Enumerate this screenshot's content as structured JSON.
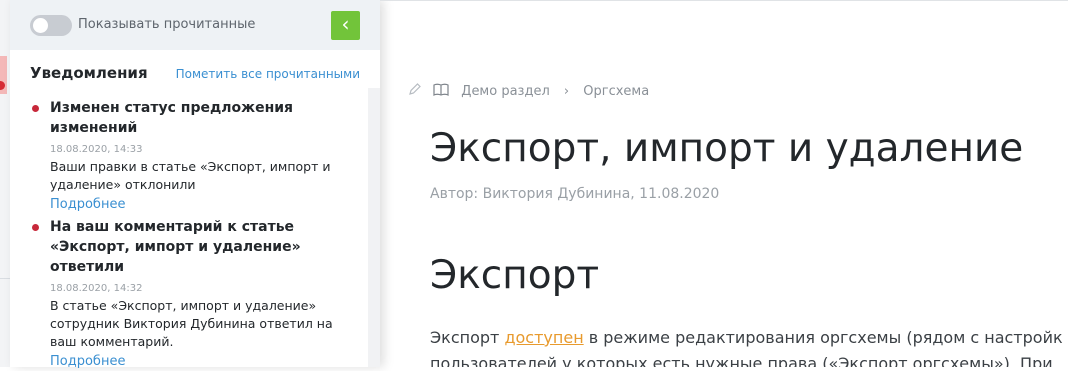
{
  "panel": {
    "toggle_label": "Показывать прочитанные",
    "collapse_icon": "‹",
    "title": "Уведомления",
    "mark_all": "Пометить все прочитанными",
    "notifications": [
      {
        "title": "Изменен статус предложения изменений",
        "date": "18.08.2020, 14:33",
        "text": "Ваши правки в статье «Экспорт, импорт и удаление» отклонили",
        "more": "Подробнее"
      },
      {
        "title": "На ваш комментарий к статье «Экспорт, импорт и удаление» ответили",
        "date": "18.08.2020, 14:32",
        "text": "В статье «Экспорт, импорт и удаление» сотрудник Виктория Дубинина ответил на ваш комментарий.",
        "more": "Подробнее"
      }
    ]
  },
  "breadcrumb": {
    "items": [
      "Демо раздел",
      "Оргсхема"
    ],
    "separator": "›"
  },
  "article": {
    "title": "Экспорт, импорт и удаление",
    "meta": "Автор: Виктория Дубинина, 11.08.2020",
    "section_heading": "Экспорт",
    "para_before": "Экспорт ",
    "para_link": "доступен",
    "para_after": " в режиме редактирования оргсхемы (рядом с настройк",
    "para_line2": "пользователей у которых есть нужные права («Экспорт оргсхемы»). При"
  },
  "colors": {
    "accent_green": "#72c43a",
    "link_blue": "#3a8fd1",
    "unread_dot": "#c7283a",
    "link_orange": "#e89a2d"
  }
}
